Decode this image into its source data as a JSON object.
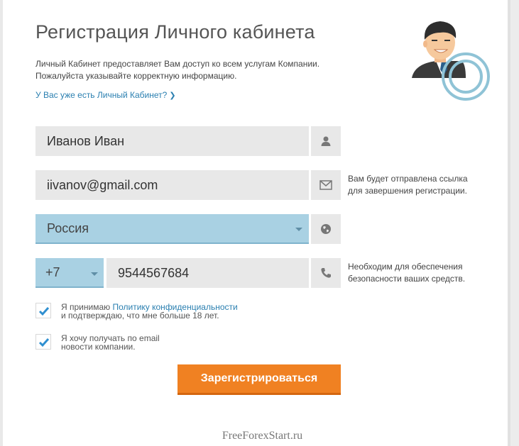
{
  "form": {
    "title": "Регистрация Личного кабинета",
    "intro_line1": "Личный Кабинет предоставляет Вам доступ ко всем услугам Компании.",
    "intro_line2": "Пожалуйста указывайте корректную информацию.",
    "login_link": "У Вас уже есть Личный Кабинет?",
    "name_value": "Иванов Иван",
    "email_value": "iivanov@gmail.com",
    "email_hint_line1": "Вам будет отправлена ссылка",
    "email_hint_line2": "для завершения регистрации.",
    "country_value": "Россия",
    "phone_code": "+7",
    "phone_value": "9544567684",
    "phone_hint_line1": "Необходим для обеспечения",
    "phone_hint_line2": "безопасности ваших средств.",
    "terms_prefix": "Я принимаю ",
    "terms_link": "Политику конфиденциальности",
    "terms_line2": "и подтверждаю, что мне больше 18 лет.",
    "terms_checked": true,
    "news_line1": "Я хочу получать по email",
    "news_line2": "новости компании.",
    "news_checked": true,
    "submit_label": "Зарегистрироваться"
  },
  "icons": {
    "name": "user-icon",
    "email": "envelope-icon",
    "country": "globe-icon",
    "phone": "phone-icon",
    "checkbox": "checkmark-icon"
  },
  "colors": {
    "accent": "#f08122",
    "link": "#2a7fb0",
    "select_bg": "#a9d1e3",
    "input_bg": "#e8e8e8"
  },
  "watermark": "FreeForexStart.ru"
}
